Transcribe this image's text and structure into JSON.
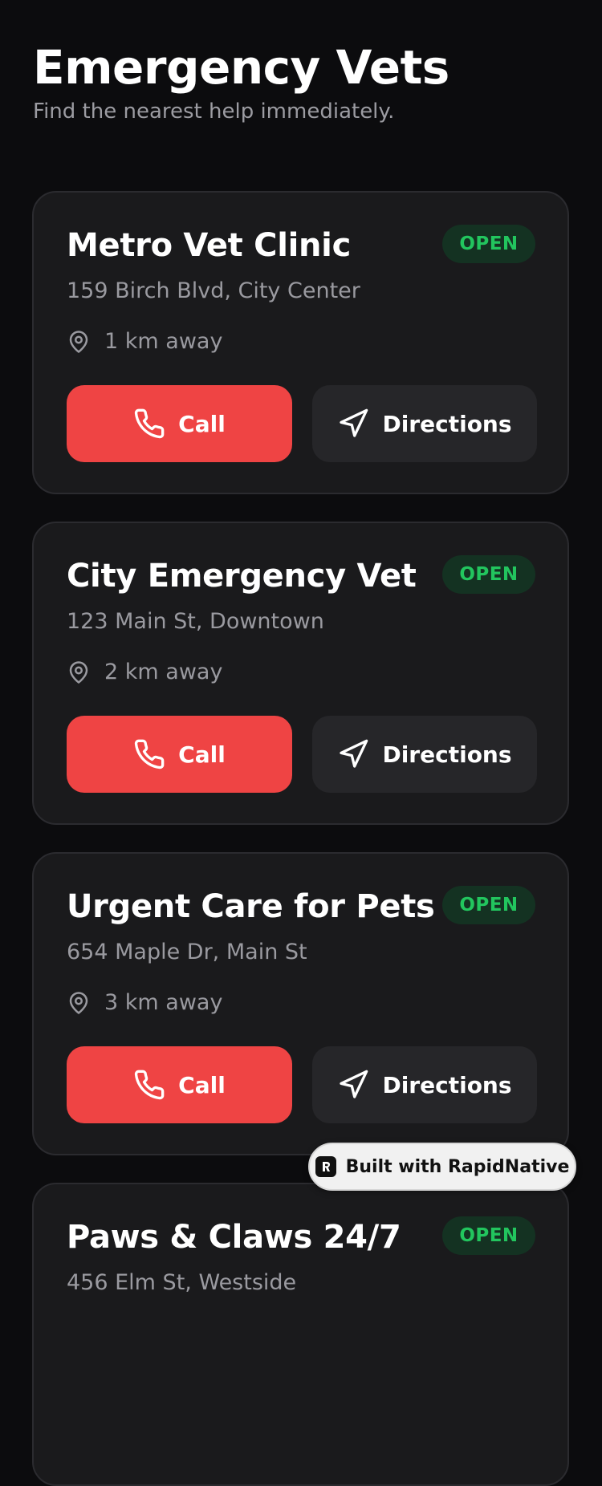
{
  "header": {
    "title": "Emergency Vets",
    "subtitle": "Find the nearest help immediately."
  },
  "colors": {
    "background": "#0c0c0e",
    "card": "#1a1a1c",
    "accent_call": "#ef4444",
    "status_open": "#22c55e"
  },
  "vets": [
    {
      "name": "Metro Vet Clinic",
      "status": "OPEN",
      "address": "159 Birch Blvd, City Center",
      "distance": "1 km away",
      "call_label": "Call",
      "directions_label": "Directions"
    },
    {
      "name": "City Emergency Vet",
      "status": "OPEN",
      "address": "123 Main St, Downtown",
      "distance": "2 km away",
      "call_label": "Call",
      "directions_label": "Directions"
    },
    {
      "name": "Urgent Care for Pets",
      "status": "OPEN",
      "address": "654 Maple Dr, Main St",
      "distance": "3 km away",
      "call_label": "Call",
      "directions_label": "Directions"
    },
    {
      "name": "Paws & Claws 24/7",
      "status": "OPEN",
      "address": "456 Elm St, Westside",
      "distance": "",
      "call_label": "",
      "directions_label": ""
    }
  ],
  "icons": {
    "distance": "map-pin-icon",
    "call": "phone-icon",
    "directions": "navigation-icon",
    "built_with": "rapidnative-logo-icon"
  },
  "built_with": {
    "label": "Built with RapidNative"
  }
}
